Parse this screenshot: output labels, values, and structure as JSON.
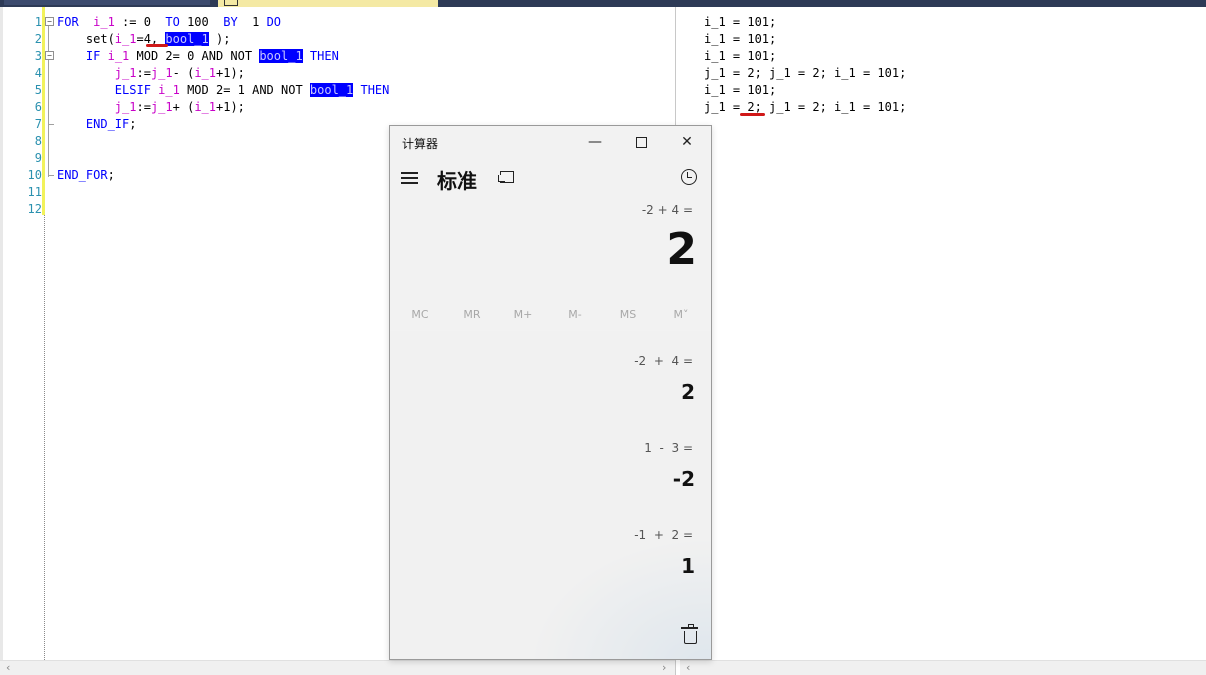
{
  "tabs": {
    "left_label": "",
    "active_label": ""
  },
  "editor": {
    "line_numbers": [
      "1",
      "2",
      "3",
      "4",
      "5",
      "6",
      "7",
      "8",
      "9",
      "10",
      "11",
      "12"
    ],
    "lines": [
      [
        [
          "kw",
          "FOR"
        ],
        [
          "t",
          "  "
        ],
        [
          "var",
          "i_1"
        ],
        [
          "t",
          " := 0  "
        ],
        [
          "kw",
          "TO"
        ],
        [
          "t",
          " 100  "
        ],
        [
          "kw",
          "BY"
        ],
        [
          "t",
          "  1 "
        ],
        [
          "kw",
          "DO"
        ]
      ],
      [
        [
          "t",
          "    set("
        ],
        [
          "var",
          "i_1"
        ],
        [
          "t",
          "=4, "
        ],
        [
          "hl",
          "bool_1"
        ],
        [
          "t",
          " );"
        ]
      ],
      [
        [
          "t",
          "    "
        ],
        [
          "kw",
          "IF"
        ],
        [
          "t",
          " "
        ],
        [
          "var",
          "i_1"
        ],
        [
          "t",
          " MOD 2= 0 AND NOT "
        ],
        [
          "hl",
          "bool_1"
        ],
        [
          "t",
          " "
        ],
        [
          "kw",
          "THEN"
        ]
      ],
      [
        [
          "t",
          "        "
        ],
        [
          "var",
          "j_1"
        ],
        [
          "t",
          ":="
        ],
        [
          "var",
          "j_1"
        ],
        [
          "t",
          "- ("
        ],
        [
          "var",
          "i_1"
        ],
        [
          "t",
          "+1);"
        ]
      ],
      [
        [
          "t",
          "        "
        ],
        [
          "kw",
          "ELSIF"
        ],
        [
          "t",
          " "
        ],
        [
          "var",
          "i_1"
        ],
        [
          "t",
          " MOD 2= 1 AND NOT "
        ],
        [
          "hl",
          "bool_1"
        ],
        [
          "t",
          " "
        ],
        [
          "kw",
          "THEN"
        ]
      ],
      [
        [
          "t",
          "        "
        ],
        [
          "var",
          "j_1"
        ],
        [
          "t",
          ":="
        ],
        [
          "var",
          "j_1"
        ],
        [
          "t",
          "+ ("
        ],
        [
          "var",
          "i_1"
        ],
        [
          "t",
          "+1);"
        ]
      ],
      [
        [
          "t",
          "    "
        ],
        [
          "kw",
          "END_IF"
        ],
        [
          "t",
          ";"
        ]
      ],
      [
        [
          "t",
          ""
        ]
      ],
      [
        [
          "t",
          ""
        ]
      ],
      [
        [
          "kw",
          "END_FOR"
        ],
        [
          "t",
          ";"
        ]
      ],
      [
        [
          "t",
          ""
        ]
      ],
      [
        [
          "t",
          ""
        ]
      ]
    ]
  },
  "output": {
    "lines": [
      "i_1 = 101;",
      "i_1 = 101;",
      "i_1 = 101;",
      "j_1 = 2; j_1 = 2; i_1 = 101;",
      "i_1 = 101;",
      "j_1 = 2; j_1 = 2; i_1 = 101;"
    ]
  },
  "calculator": {
    "window_title": "计算器",
    "minimize_glyph": "—",
    "close_glyph": "✕",
    "mode_title": "标准",
    "expression": "-2 + 4 =",
    "result": "2",
    "memory_buttons": [
      "MC",
      "MR",
      "M+",
      "M-",
      "MS",
      "M˅"
    ],
    "history": [
      {
        "expr": "-2  +  4 =",
        "result": "2"
      },
      {
        "expr": "1  -  3 =",
        "result": "-2"
      },
      {
        "expr": "-1  +  2 =",
        "result": "1"
      }
    ]
  },
  "colors": {
    "keyword": "#0000ff",
    "variable": "#c800c8",
    "highlight_bg": "#0000ff",
    "annotation": "#d01818"
  }
}
